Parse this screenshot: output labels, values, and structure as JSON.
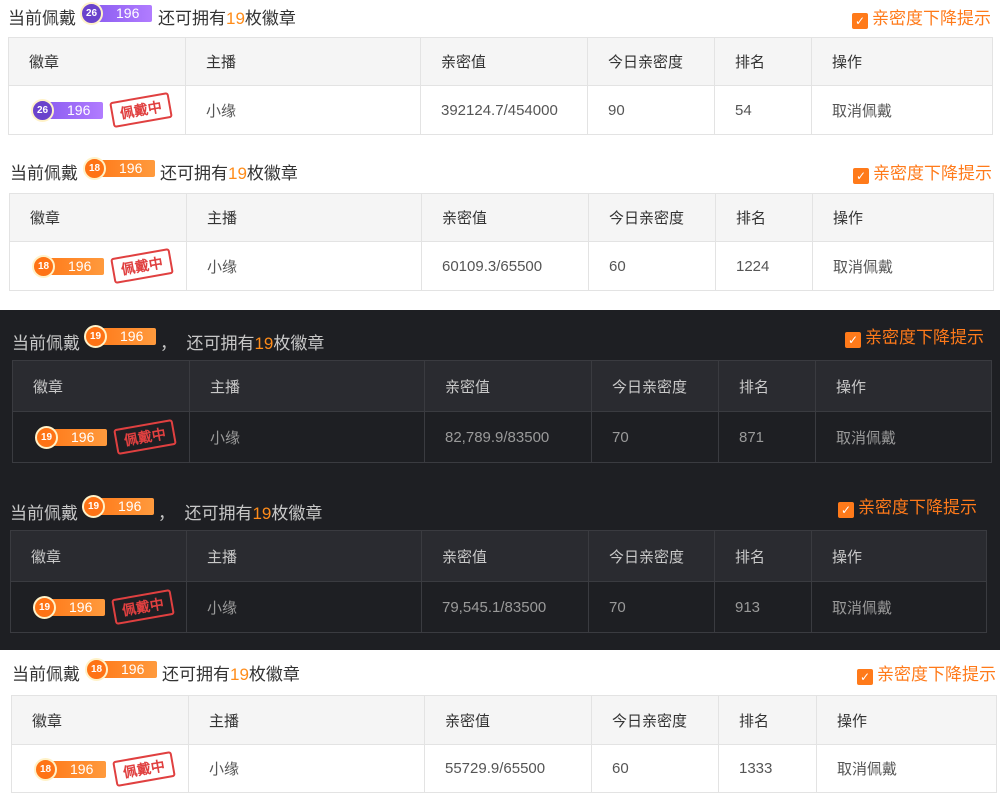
{
  "labels": {
    "current_wearing": "当前佩戴",
    "still_have_prefix": "还可拥有",
    "still_have_suffix": "枚徽章",
    "comma": "，",
    "intimacy_alert": "亲密度下降提示",
    "check_glyph": "✓",
    "wearing_stamp": "佩戴中"
  },
  "columns": [
    "徽章",
    "主播",
    "亲密值",
    "今日亲密度",
    "排名",
    "操作"
  ],
  "panels": [
    {
      "theme": "light",
      "badge": {
        "level": "26",
        "value": "196",
        "color": "purple"
      },
      "remaining": "19",
      "row": {
        "anchor": "小缘",
        "intimacy": "392124.7/454000",
        "today": "90",
        "rank": "54",
        "action": "取消佩戴"
      }
    },
    {
      "theme": "light",
      "badge": {
        "level": "18",
        "value": "196",
        "color": "orange"
      },
      "remaining": "19",
      "row": {
        "anchor": "小缘",
        "intimacy": "60109.3/65500",
        "today": "60",
        "rank": "1224",
        "action": "取消佩戴"
      }
    },
    {
      "theme": "dark",
      "badge": {
        "level": "19",
        "value": "196",
        "color": "orange"
      },
      "remaining": "19",
      "row": {
        "anchor": "小缘",
        "intimacy": "82,789.9/83500",
        "today": "70",
        "rank": "871",
        "action": "取消佩戴"
      }
    },
    {
      "theme": "dark",
      "badge": {
        "level": "19",
        "value": "196",
        "color": "orange"
      },
      "remaining": "19",
      "row": {
        "anchor": "小缘",
        "intimacy": "79,545.1/83500",
        "today": "70",
        "rank": "913",
        "action": "取消佩戴"
      }
    },
    {
      "theme": "light",
      "badge": {
        "level": "18",
        "value": "196",
        "color": "orange"
      },
      "remaining": "19",
      "row": {
        "anchor": "小缘",
        "intimacy": "55729.9/65500",
        "today": "60",
        "rank": "1333",
        "action": "取消佩戴"
      }
    }
  ],
  "colors": {
    "accent": "#ff7a1a",
    "link": "#2f8fd6",
    "dark_bg": "#1e1f23",
    "purple_badge": "#8a5cf0"
  }
}
